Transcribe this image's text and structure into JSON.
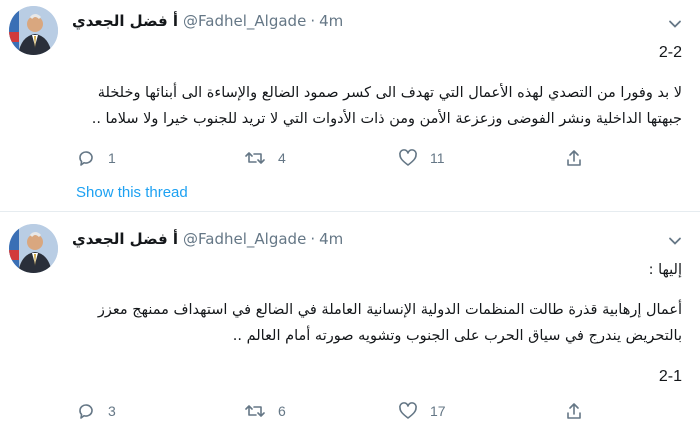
{
  "tweets": [
    {
      "author": {
        "name": "أ فضل الجعدي",
        "handle": "@Fadhel_Algade",
        "time": "4m"
      },
      "thread_label": "2-2",
      "text": "لا بد وفورا من التصدي لهذه الأعمال التي تهدف الى كسر صمود الضالع والإساءة الى أبنائها وخلخلة جبهتها الداخلية ونشر الفوضى وزعزعة الأمن ومن ذات الأدوات التي لا تريد للجنوب خيرا ولا سلاما ..",
      "actions": {
        "reply": "1",
        "retweet": "4",
        "like": "11"
      },
      "show_thread": "Show this thread"
    },
    {
      "author": {
        "name": "أ فضل الجعدي",
        "handle": "@Fadhel_Algade",
        "time": "4m"
      },
      "lead": "إليها :",
      "text": "أعمال إرهابية قذرة طالت المنظمات الدولية الإنسانية العاملة في الضالع في استهداف ممنهج معزز بالتحريض يندرج في سياق الحرب على الجنوب وتشويه صورته أمام العالم ..",
      "thread_label": "2-1",
      "actions": {
        "reply": "3",
        "retweet": "6",
        "like": "17"
      }
    }
  ],
  "icons": {
    "reply": "reply-icon",
    "retweet": "retweet-icon",
    "like": "heart-icon",
    "share": "share-icon",
    "menu": "chevron-down-icon"
  },
  "colors": {
    "link": "#1da1f2",
    "muted": "#657786",
    "text": "#14171a",
    "divider": "#e6ecf0"
  }
}
